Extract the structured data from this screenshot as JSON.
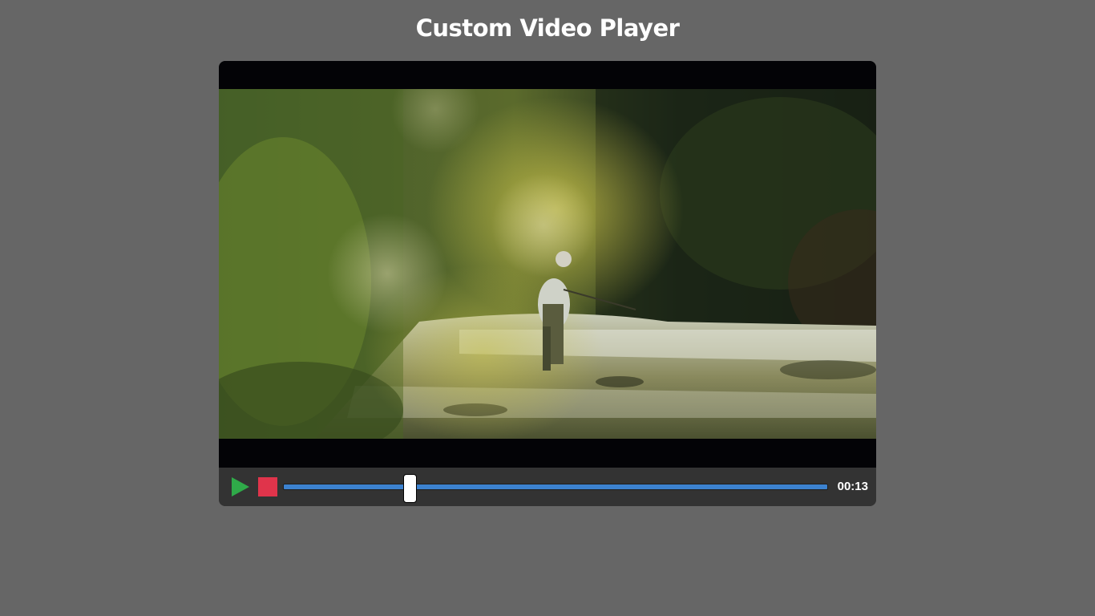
{
  "page": {
    "title": "Custom Video Player"
  },
  "player": {
    "state": "paused",
    "current_time": "00:13",
    "progress_fraction": 0.233,
    "colors": {
      "play_icon": "#2faa49",
      "stop_icon": "#e0344b",
      "progress_fill": "#3c82d0",
      "background": "#666666"
    },
    "controls": [
      {
        "name": "play-button",
        "icon": "play-icon"
      },
      {
        "name": "stop-button",
        "icon": "stop-icon"
      },
      {
        "name": "progress-slider",
        "icon": "slider-thumb"
      }
    ]
  }
}
